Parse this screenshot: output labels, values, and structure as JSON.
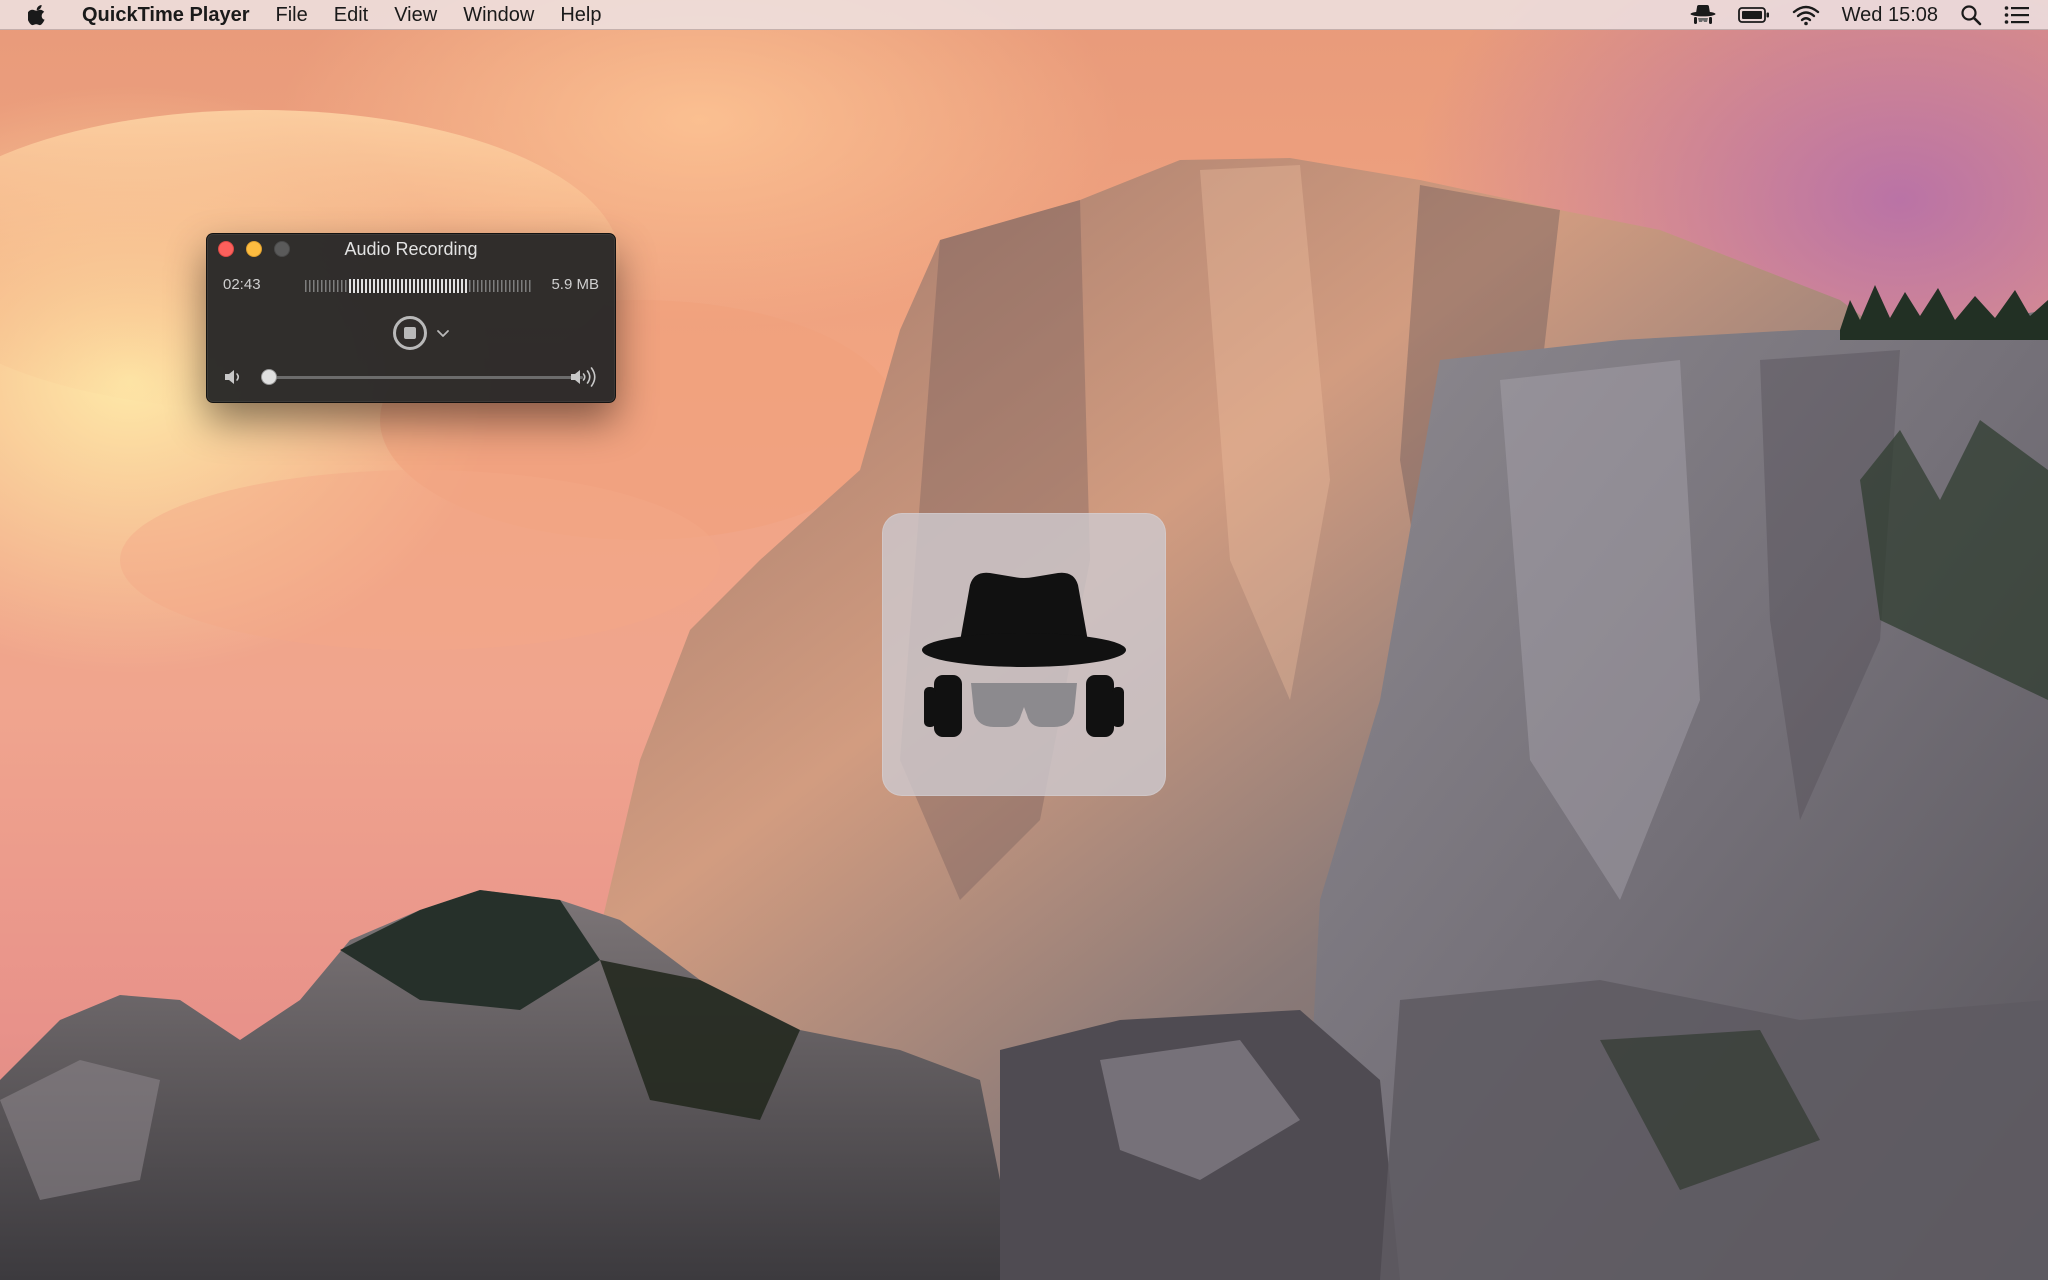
{
  "menubar": {
    "apple_icon": "apple-icon",
    "app_name": "QuickTime Player",
    "menus": [
      "File",
      "Edit",
      "View",
      "Window",
      "Help"
    ],
    "status_icons": [
      "incognito-hat-icon",
      "battery-icon",
      "wifi-icon"
    ],
    "clock": "Wed 15:08",
    "spotlight_icon": "search-icon",
    "notification_icon": "list-icon"
  },
  "recorder_window": {
    "title": "Audio Recording",
    "elapsed": "02:43",
    "file_size": "5.9 MB",
    "record_state": "recording",
    "volume_level": 0.0
  },
  "hud": {
    "icon": "incognito-spy-icon"
  },
  "colors": {
    "close": "#fc605c",
    "minimize": "#fdbc40",
    "zoom_disabled": "#5a5a5a",
    "window_bg": "#282828"
  }
}
